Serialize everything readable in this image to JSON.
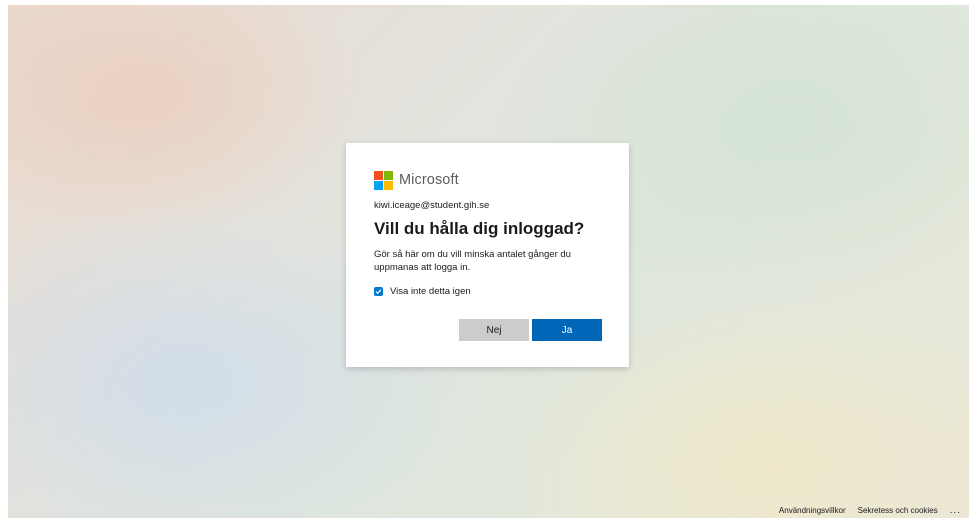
{
  "brand": {
    "name": "Microsoft",
    "logo_colors": [
      "#f25022",
      "#7fba00",
      "#00a4ef",
      "#ffb900"
    ]
  },
  "dialog": {
    "account": "kiwi.iceage@student.gih.se",
    "title": "Vill du hålla dig inloggad?",
    "description": "Gör så här om du vill minska antalet gånger du uppmanas att logga in.",
    "checkbox": {
      "label": "Visa inte detta igen",
      "checked": true
    },
    "buttons": {
      "no_label": "Nej",
      "yes_label": "Ja"
    }
  },
  "footer": {
    "terms": "Användningsvillkor",
    "privacy": "Sekretess och cookies",
    "more": "..."
  },
  "colors": {
    "primary": "#0067b8",
    "secondary_button": "#cccccc",
    "checkbox": "#0078d4",
    "text": "#1b1b1b"
  }
}
